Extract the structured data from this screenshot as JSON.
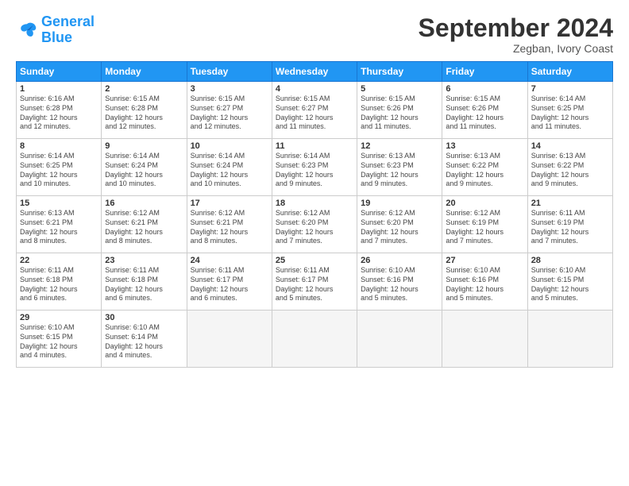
{
  "header": {
    "logo_line1": "General",
    "logo_line2": "Blue",
    "month_title": "September 2024",
    "location": "Zegban, Ivory Coast"
  },
  "weekdays": [
    "Sunday",
    "Monday",
    "Tuesday",
    "Wednesday",
    "Thursday",
    "Friday",
    "Saturday"
  ],
  "weeks": [
    [
      {
        "day": "1",
        "info": "Sunrise: 6:16 AM\nSunset: 6:28 PM\nDaylight: 12 hours\nand 12 minutes."
      },
      {
        "day": "2",
        "info": "Sunrise: 6:15 AM\nSunset: 6:28 PM\nDaylight: 12 hours\nand 12 minutes."
      },
      {
        "day": "3",
        "info": "Sunrise: 6:15 AM\nSunset: 6:27 PM\nDaylight: 12 hours\nand 12 minutes."
      },
      {
        "day": "4",
        "info": "Sunrise: 6:15 AM\nSunset: 6:27 PM\nDaylight: 12 hours\nand 11 minutes."
      },
      {
        "day": "5",
        "info": "Sunrise: 6:15 AM\nSunset: 6:26 PM\nDaylight: 12 hours\nand 11 minutes."
      },
      {
        "day": "6",
        "info": "Sunrise: 6:15 AM\nSunset: 6:26 PM\nDaylight: 12 hours\nand 11 minutes."
      },
      {
        "day": "7",
        "info": "Sunrise: 6:14 AM\nSunset: 6:25 PM\nDaylight: 12 hours\nand 11 minutes."
      }
    ],
    [
      {
        "day": "8",
        "info": "Sunrise: 6:14 AM\nSunset: 6:25 PM\nDaylight: 12 hours\nand 10 minutes."
      },
      {
        "day": "9",
        "info": "Sunrise: 6:14 AM\nSunset: 6:24 PM\nDaylight: 12 hours\nand 10 minutes."
      },
      {
        "day": "10",
        "info": "Sunrise: 6:14 AM\nSunset: 6:24 PM\nDaylight: 12 hours\nand 10 minutes."
      },
      {
        "day": "11",
        "info": "Sunrise: 6:14 AM\nSunset: 6:23 PM\nDaylight: 12 hours\nand 9 minutes."
      },
      {
        "day": "12",
        "info": "Sunrise: 6:13 AM\nSunset: 6:23 PM\nDaylight: 12 hours\nand 9 minutes."
      },
      {
        "day": "13",
        "info": "Sunrise: 6:13 AM\nSunset: 6:22 PM\nDaylight: 12 hours\nand 9 minutes."
      },
      {
        "day": "14",
        "info": "Sunrise: 6:13 AM\nSunset: 6:22 PM\nDaylight: 12 hours\nand 9 minutes."
      }
    ],
    [
      {
        "day": "15",
        "info": "Sunrise: 6:13 AM\nSunset: 6:21 PM\nDaylight: 12 hours\nand 8 minutes."
      },
      {
        "day": "16",
        "info": "Sunrise: 6:12 AM\nSunset: 6:21 PM\nDaylight: 12 hours\nand 8 minutes."
      },
      {
        "day": "17",
        "info": "Sunrise: 6:12 AM\nSunset: 6:21 PM\nDaylight: 12 hours\nand 8 minutes."
      },
      {
        "day": "18",
        "info": "Sunrise: 6:12 AM\nSunset: 6:20 PM\nDaylight: 12 hours\nand 7 minutes."
      },
      {
        "day": "19",
        "info": "Sunrise: 6:12 AM\nSunset: 6:20 PM\nDaylight: 12 hours\nand 7 minutes."
      },
      {
        "day": "20",
        "info": "Sunrise: 6:12 AM\nSunset: 6:19 PM\nDaylight: 12 hours\nand 7 minutes."
      },
      {
        "day": "21",
        "info": "Sunrise: 6:11 AM\nSunset: 6:19 PM\nDaylight: 12 hours\nand 7 minutes."
      }
    ],
    [
      {
        "day": "22",
        "info": "Sunrise: 6:11 AM\nSunset: 6:18 PM\nDaylight: 12 hours\nand 6 minutes."
      },
      {
        "day": "23",
        "info": "Sunrise: 6:11 AM\nSunset: 6:18 PM\nDaylight: 12 hours\nand 6 minutes."
      },
      {
        "day": "24",
        "info": "Sunrise: 6:11 AM\nSunset: 6:17 PM\nDaylight: 12 hours\nand 6 minutes."
      },
      {
        "day": "25",
        "info": "Sunrise: 6:11 AM\nSunset: 6:17 PM\nDaylight: 12 hours\nand 5 minutes."
      },
      {
        "day": "26",
        "info": "Sunrise: 6:10 AM\nSunset: 6:16 PM\nDaylight: 12 hours\nand 5 minutes."
      },
      {
        "day": "27",
        "info": "Sunrise: 6:10 AM\nSunset: 6:16 PM\nDaylight: 12 hours\nand 5 minutes."
      },
      {
        "day": "28",
        "info": "Sunrise: 6:10 AM\nSunset: 6:15 PM\nDaylight: 12 hours\nand 5 minutes."
      }
    ],
    [
      {
        "day": "29",
        "info": "Sunrise: 6:10 AM\nSunset: 6:15 PM\nDaylight: 12 hours\nand 4 minutes."
      },
      {
        "day": "30",
        "info": "Sunrise: 6:10 AM\nSunset: 6:14 PM\nDaylight: 12 hours\nand 4 minutes."
      },
      {
        "day": "",
        "info": ""
      },
      {
        "day": "",
        "info": ""
      },
      {
        "day": "",
        "info": ""
      },
      {
        "day": "",
        "info": ""
      },
      {
        "day": "",
        "info": ""
      }
    ]
  ]
}
